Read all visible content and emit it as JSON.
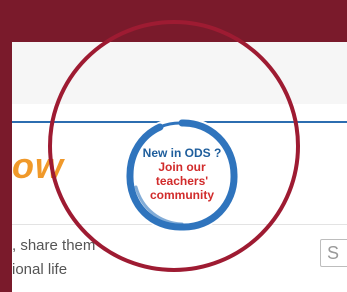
{
  "header": {
    "headline_fragment": "ow"
  },
  "intro": {
    "line1_fragment": ", share them",
    "line2_fragment": "ional life"
  },
  "search": {
    "value_fragment": "S"
  },
  "badge": {
    "title": "New in ODS ?",
    "cta_line1": "Join our",
    "cta_line2": "teachers'",
    "cta_line3": "community"
  },
  "colors": {
    "frame": "#7a1a2b",
    "ring": "#9e1b32",
    "brush": "#2f74bd",
    "accent_orange": "#f0992a",
    "badge_title": "#1f5e9c",
    "badge_cta": "#d12b2b"
  }
}
